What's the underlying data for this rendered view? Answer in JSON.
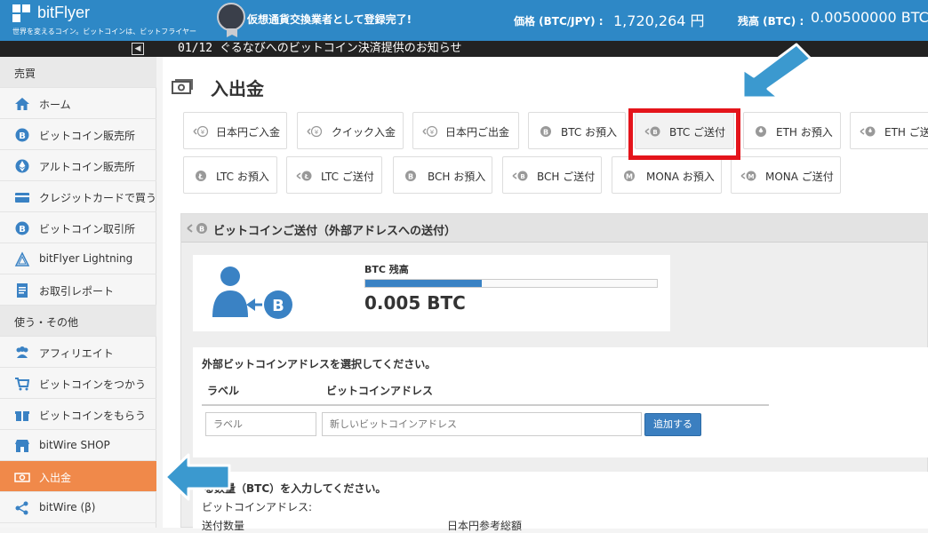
{
  "header": {
    "logo_text": "bitFlyer",
    "tagline": "世界を変えるコイン。ビットコインは、ビットフライヤー",
    "announcement": "仮想通貨交換業者として登録完了!",
    "price_label": "価格 (BTC/JPY) :",
    "price_value": "1,720,264 円",
    "balance_label": "残高 (BTC) :",
    "balance_value": "0.00500000 BTC"
  },
  "ticker": "01/12 ぐるなびへのビットコイン決済提供のお知らせ",
  "sidebar": {
    "items": [
      {
        "label": "売買",
        "type": "section"
      },
      {
        "label": "ホーム",
        "icon": "home-icon"
      },
      {
        "label": "ビットコイン販売所",
        "icon": "bitcoin-icon"
      },
      {
        "label": "アルトコイン販売所",
        "icon": "ethereum-icon"
      },
      {
        "label": "クレジットカードで買う",
        "icon": "credit-card-icon"
      },
      {
        "label": "ビットコイン取引所",
        "icon": "bitcoin-icon"
      },
      {
        "label": "bitFlyer Lightning",
        "icon": "lightning-icon"
      },
      {
        "label": "お取引レポート",
        "icon": "report-icon"
      },
      {
        "label": "使う・その他",
        "type": "section"
      },
      {
        "label": "アフィリエイト",
        "icon": "users-icon"
      },
      {
        "label": "ビットコインをつかう",
        "icon": "cart-icon"
      },
      {
        "label": "ビットコインをもらう",
        "icon": "gift-icon"
      },
      {
        "label": "bitWire SHOP",
        "icon": "shop-icon"
      },
      {
        "label": "入出金",
        "icon": "money-icon",
        "active": true
      },
      {
        "label": "bitWire (β)",
        "icon": "share-icon"
      }
    ]
  },
  "main": {
    "title": "入出金",
    "tabs_row1": [
      {
        "label": "日本円ご入金",
        "icon": "yen-deposit-icon"
      },
      {
        "label": "クイック入金",
        "icon": "yen-quick-icon"
      },
      {
        "label": "日本円ご出金",
        "icon": "yen-withdraw-icon"
      },
      {
        "label": "BTC お預入",
        "icon": "btc-deposit-icon"
      },
      {
        "label": "BTC ご送付",
        "icon": "btc-send-icon",
        "active": true
      },
      {
        "label": "ETH お預入",
        "icon": "eth-deposit-icon"
      },
      {
        "label": "ETH ご送付",
        "icon": "eth-send-icon"
      }
    ],
    "tabs_row2": [
      {
        "label": "LTC お預入",
        "icon": "ltc-deposit-icon"
      },
      {
        "label": "LTC ご送付",
        "icon": "ltc-send-icon"
      },
      {
        "label": "BCH お預入",
        "icon": "bch-deposit-icon"
      },
      {
        "label": "BCH ご送付",
        "icon": "bch-send-icon"
      },
      {
        "label": "MONA お預入",
        "icon": "mona-deposit-icon"
      },
      {
        "label": "MONA ご送付",
        "icon": "mona-send-icon"
      }
    ],
    "panel": {
      "title": "ビットコインご送付（外部アドレスへの送付）",
      "balance_title": "BTC 残高",
      "balance_fill_percent": 40,
      "balance_amount": "0.005 BTC",
      "address_section": {
        "title": "外部ビットコインアドレスを選択してください。",
        "col_label": "ラベル",
        "col_address": "ビットコインアドレス",
        "label_placeholder": "ラベル",
        "address_placeholder": "新しいビットコインアドレス",
        "add_button": "追加する"
      },
      "amount_section": {
        "title": "る数量（BTC）を入力してください。",
        "address_label": "ビットコインアドレス:",
        "amount_label": "送付数量",
        "jpy_label": "日本円参考総額"
      }
    }
  },
  "colors": {
    "header_blue": "#2e88c6",
    "active_orange": "#f0894a",
    "highlight_red": "#e4141b",
    "arrow_blue": "#3b99cf"
  }
}
